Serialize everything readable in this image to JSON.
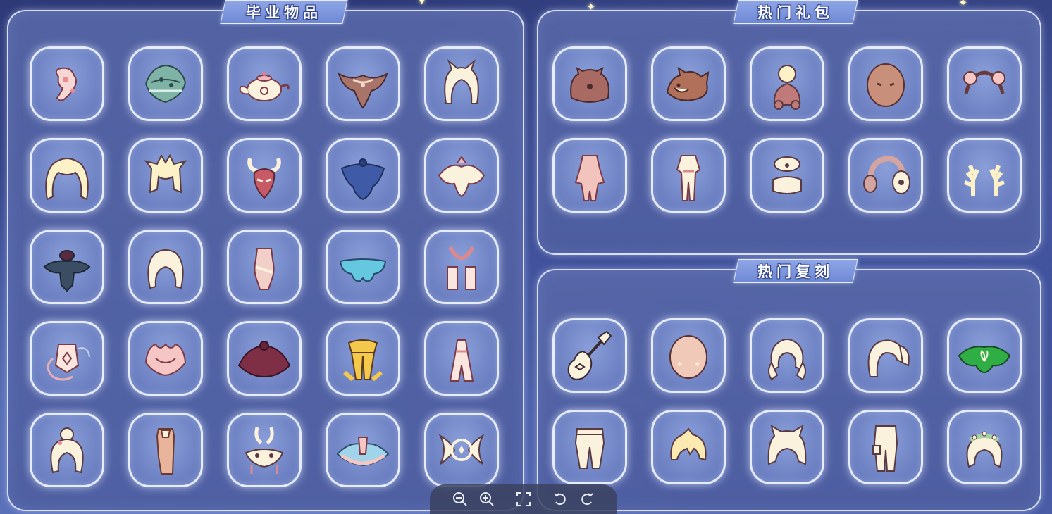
{
  "panels": {
    "graduation": {
      "title": "毕业物品"
    },
    "hot_packs": {
      "title": "热门礼包"
    },
    "hot_reruns": {
      "title": "热门复刻"
    }
  },
  "toolbar": {
    "buttons": [
      "zoom-out-icon",
      "zoom-in-icon",
      "fit-screen-icon",
      "rotate-left-icon",
      "rotate-right-icon"
    ]
  },
  "colors": {
    "panel_border": "#eaf0ff",
    "slot_fill": "#7184c4",
    "title_fill": "#7f98de",
    "cream": "#fbf2de",
    "outline": "#5a3040",
    "green_accent": "#2fae46"
  }
}
